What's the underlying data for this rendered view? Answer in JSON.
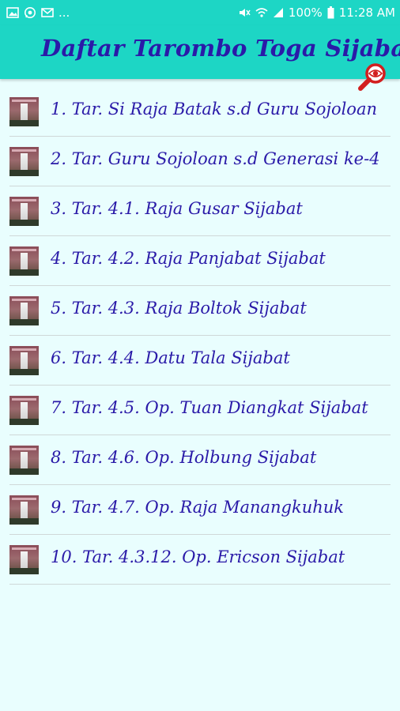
{
  "status_bar": {
    "left_icons": [
      "image-icon",
      "whatsapp-icon",
      "mail-icon"
    ],
    "overflow": "...",
    "right_icons": [
      "mute-icon",
      "wifi-icon",
      "signal-icon"
    ],
    "battery": "100%",
    "time": "11:28 AM"
  },
  "app_bar": {
    "title": "Daftar Tarombo Toga Sijabat",
    "search_icon": "search-eye-icon",
    "color": "#1dd6c5",
    "title_color": "#2a1aa8"
  },
  "list": {
    "items": [
      {
        "label": "1. Tar. Si Raja Batak s.d Guru Sojoloan"
      },
      {
        "label": "2. Tar. Guru Sojoloan s.d Generasi ke-4"
      },
      {
        "label": "3. Tar. 4.1. Raja Gusar Sijabat"
      },
      {
        "label": "4. Tar. 4.2. Raja Panjabat Sijabat"
      },
      {
        "label": "5. Tar. 4.3. Raja Boltok Sijabat"
      },
      {
        "label": "6. Tar. 4.4. Datu Tala Sijabat"
      },
      {
        "label": "7. Tar. 4.5. Op. Tuan Diangkat Sijabat"
      },
      {
        "label": "8. Tar. 4.6. Op. Holbung Sijabat"
      },
      {
        "label": "9. Tar. 4.7. Op. Raja Manangkuhuk"
      },
      {
        "label": "10. Tar. 4.3.12. Op. Ericson Sijabat"
      }
    ]
  }
}
